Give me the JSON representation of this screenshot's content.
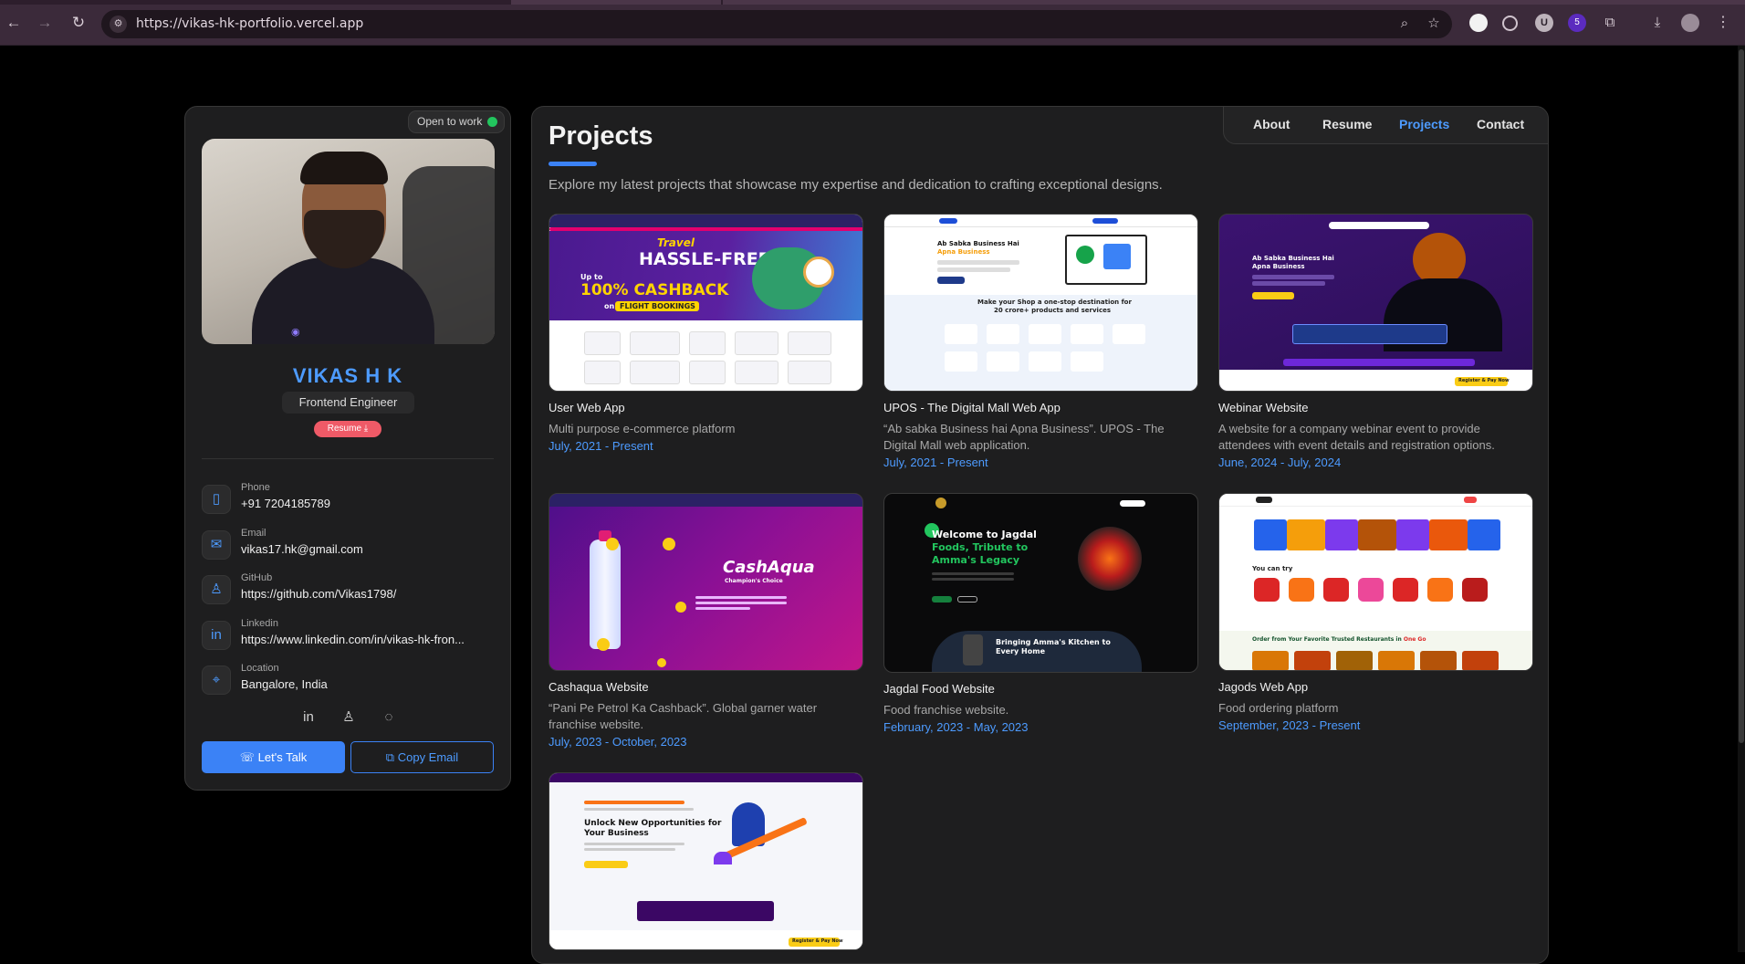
{
  "browser": {
    "url": "https://vikas-hk-portfolio.vercel.app",
    "extension_badge": "5"
  },
  "profile": {
    "status": "Open to work",
    "name": "VIKAS H K",
    "role": "Frontend Engineer",
    "resume_label": "Resume",
    "contacts": [
      {
        "label": "Phone",
        "value": "+91 7204185789",
        "icon": "phone-icon"
      },
      {
        "label": "Email",
        "value": "vikas17.hk@gmail.com",
        "icon": "mail-icon"
      },
      {
        "label": "GitHub",
        "value": "https://github.com/Vikas1798/",
        "icon": "github-icon"
      },
      {
        "label": "Linkedin",
        "value": "https://www.linkedin.com/in/vikas-hk-fron...",
        "icon": "linkedin-icon"
      },
      {
        "label": "Location",
        "value": "Bangalore, India",
        "icon": "location-icon"
      }
    ],
    "lets_talk": "Let's Talk",
    "copy_email": "Copy Email"
  },
  "nav": {
    "tabs": [
      "About",
      "Resume",
      "Projects",
      "Contact"
    ],
    "active": "Projects"
  },
  "projects_page": {
    "title": "Projects",
    "intro": "Explore my latest projects that showcase my expertise and dedication to crafting exceptional designs.",
    "items": [
      {
        "title": "User Web App",
        "desc": "Multi purpose e-commerce platform",
        "date": "July, 2021 - Present"
      },
      {
        "title": "UPOS - The Digital Mall Web App",
        "desc": "“Ab sabka Business hai Apna Business”. UPOS - The Digital Mall web application.",
        "date": "July, 2021 - Present"
      },
      {
        "title": "Webinar Website",
        "desc": "A website for a company webinar event to provide attendees with event details and registration options.",
        "date": "June, 2024 - July, 2024"
      },
      {
        "title": "Cashaqua Website",
        "desc": "“Pani Pe Petrol Ka Cashback”. Global garner water franchise website.",
        "date": "July, 2023 - October, 2023"
      },
      {
        "title": "Jagdal Food Website",
        "desc": "Food franchise website.",
        "date": "February, 2023 - May, 2023"
      },
      {
        "title": "Jagods Web App",
        "desc": "Food ordering platform",
        "date": "September, 2023 - Present"
      },
      {
        "title": "",
        "desc": "",
        "date": ""
      }
    ]
  },
  "thumb_text": {
    "t1_script": "Travel",
    "t1_big": "HASSLE-FREE",
    "t1_small": "Up to",
    "t1_cash": "100% CASHBACK",
    "t1_on": "on",
    "t1_flight": "FLIGHT BOOKINGS",
    "t2_head1": "Ab Sabka Business Hai",
    "t2_head2": "Apna Business",
    "t2_mid": "Make your Shop a one-stop destination for",
    "t2_mid2": "20 crore+ products and services",
    "t3_head1": "Ab Sabka Business Hai",
    "t3_head2": "Apna Business",
    "t3_cta": "Register & Pay Now",
    "t4_brand": "CashAqua",
    "t4_tag": "Champion's Choice",
    "t5_head1": "Welcome to Jagdal",
    "t5_head2": "Foods, Tribute to",
    "t5_head3": "Amma's Legacy",
    "t5_box": "Bringing Amma's Kitchen to",
    "t5_box2": "Every Home",
    "t6_try": "You can try",
    "t6_order": "Order from Your Favorite Trusted Restaurants in",
    "t6_one": "One Go",
    "t7_head1": "Unlock New Opportunities for",
    "t7_head2": "Your Business",
    "t7_cta": "Register & Pay Now"
  },
  "colors": {
    "accent": "#3b82f6",
    "status_green": "#22c55e",
    "resume_red": "#ef5a67",
    "panel": "#1e1e1f"
  }
}
